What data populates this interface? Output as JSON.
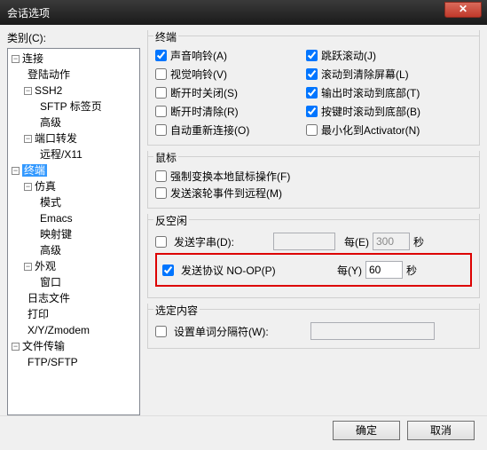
{
  "title": "会话选项",
  "category_label": "类别(C):",
  "tree": {
    "n0": "连接",
    "n1": "登陆动作",
    "n2": "SSH2",
    "n3": "SFTP 标签页",
    "n4": "高级",
    "n5": "端口转发",
    "n6": "远程/X11",
    "n7": "终端",
    "n8": "仿真",
    "n9": "模式",
    "n10": "Emacs",
    "n11": "映射键",
    "n12": "高级",
    "n13": "外观",
    "n14": "窗口",
    "n15": "日志文件",
    "n16": "打印",
    "n17": "X/Y/Zmodem",
    "n18": "文件传输",
    "n19": "FTP/SFTP"
  },
  "groups": {
    "terminal": "终端",
    "mouse": "鼠标",
    "antiidle": "反空闲",
    "selection": "选定内容"
  },
  "cb": {
    "bell": "声音响铃(A)",
    "jump": "跳跃滚动(J)",
    "vbell": "视觉响铃(V)",
    "clrscroll": "滚动到清除屏幕(L)",
    "closedisc": "断开时关闭(S)",
    "outbottom": "输出时滚动到底部(T)",
    "clrdisc": "断开时清除(R)",
    "keybottom": "按键时滚动到底部(B)",
    "autoreconn": "自动重新连接(O)",
    "minactivator": "最小化到Activator(N)",
    "forcelocal": "强制变换本地鼠标操作(F)",
    "sendwheel": "发送滚轮事件到远程(M)",
    "sendstr": "发送字串(D):",
    "sendproto": "发送协议 NO-OP(P)",
    "worddelim": "设置单词分隔符(W):"
  },
  "antiidle": {
    "every1": "每(E)",
    "every2": "每(Y)",
    "secs": "秒",
    "val1": "300",
    "val2": "60"
  },
  "buttons": {
    "ok": "确定",
    "cancel": "取消"
  }
}
